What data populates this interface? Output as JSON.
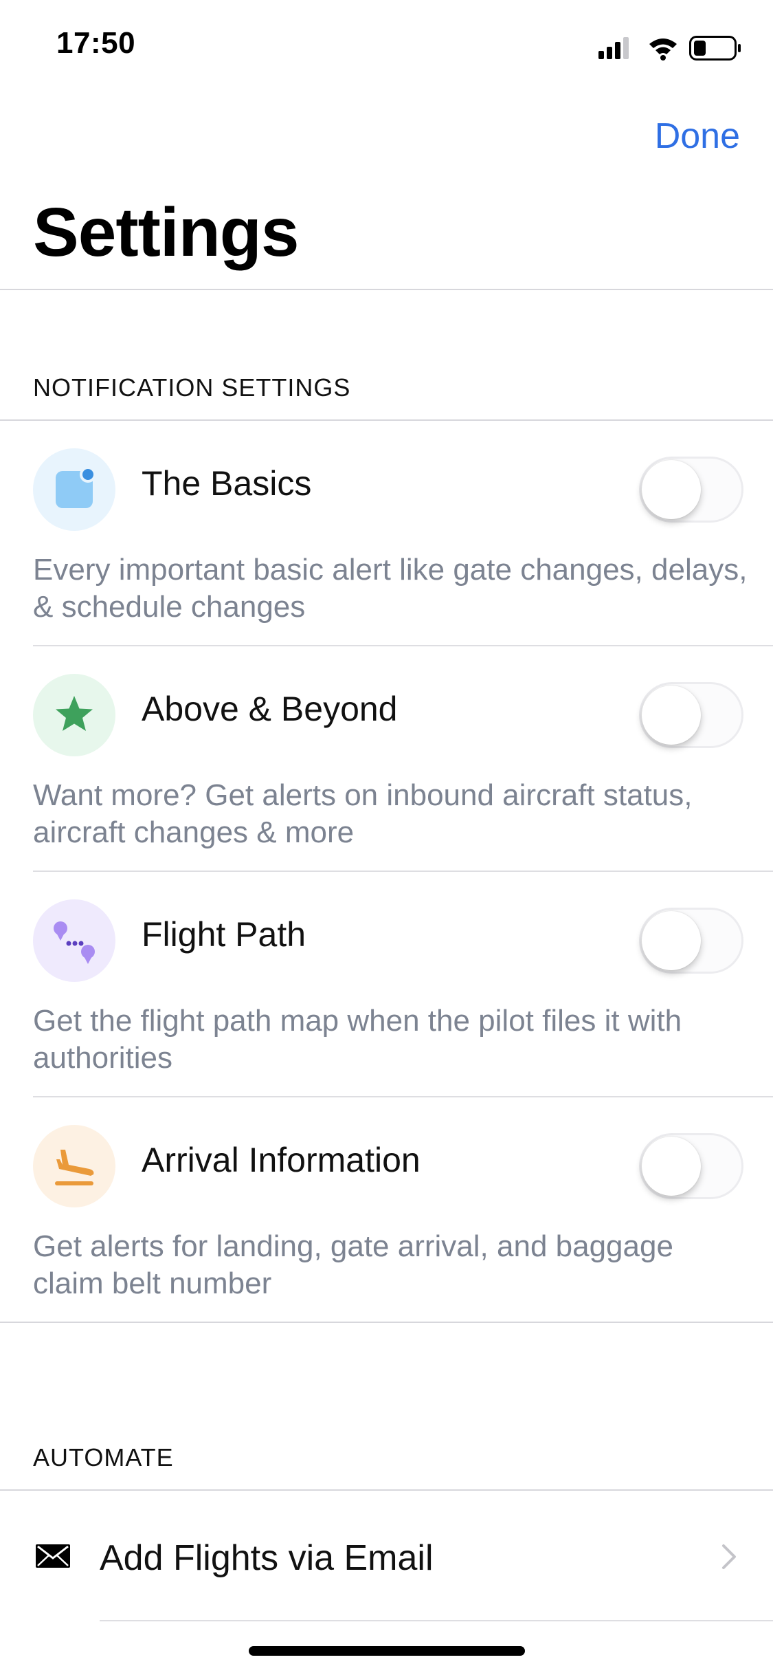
{
  "status_bar": {
    "time": "17:50",
    "icons": [
      "signal-icon",
      "wifi-icon",
      "battery-icon"
    ]
  },
  "nav": {
    "done_label": "Done"
  },
  "page": {
    "title": "Settings"
  },
  "notification_section": {
    "header": "NOTIFICATION SETTINGS",
    "items": [
      {
        "label": "The Basics",
        "description": "Every important basic alert like gate changes, delays, & schedule changes",
        "icon": "notification-badge-icon",
        "enabled": false,
        "icon_color": "#8fcbf6"
      },
      {
        "label": "Above & Beyond",
        "description": "Want more? Get alerts on inbound aircraft status, aircraft changes & more",
        "icon": "star-icon",
        "enabled": false,
        "icon_color": "#3ea15c"
      },
      {
        "label": "Flight Path",
        "description": "Get the flight path map when the pilot files it with authorities",
        "icon": "flight-path-icon",
        "enabled": false,
        "icon_color": "#a98cf2"
      },
      {
        "label": "Arrival Information",
        "description": "Get alerts for landing, gate arrival, and baggage claim belt number",
        "icon": "plane-landing-icon",
        "enabled": false,
        "icon_color": "#ea9a3a"
      }
    ]
  },
  "automate_section": {
    "header": "AUTOMATE",
    "items": [
      {
        "label": "Add Flights via Email",
        "icon": "envelope-icon"
      }
    ]
  },
  "colors": {
    "accent": "#2f6fe4",
    "secondary_text": "#7c8391",
    "separator": "#d7d7dc"
  }
}
